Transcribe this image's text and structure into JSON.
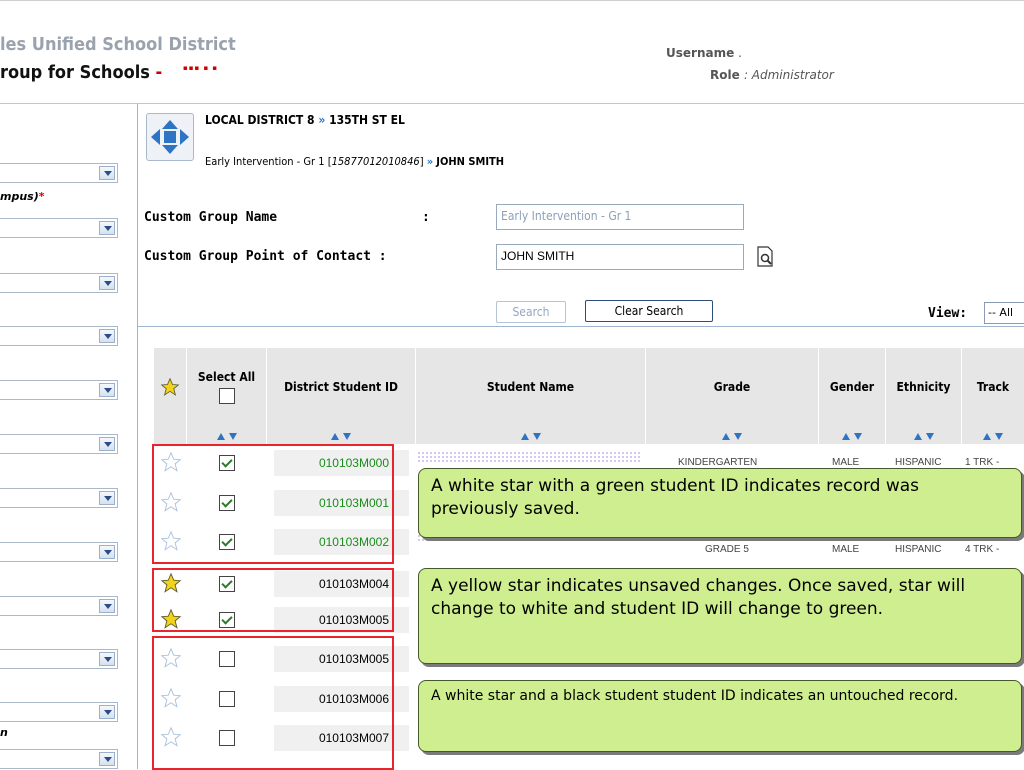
{
  "header": {
    "brand_line1": "les Unified School District",
    "brand_line2": "roup for Schools",
    "brand_dash": " -",
    "username_label": "Username",
    "username_value": " .",
    "role_label": "Role",
    "role_value": ": Administrator"
  },
  "sidebar": {
    "campus_label": "mpus)",
    "campus_required": "*",
    "last_label": "n"
  },
  "breadcrumb": {
    "line1_part1": "LOCAL DISTRICT 8",
    "separator": "»",
    "line1_part2": "135TH ST EL",
    "group_name": "Early Intervention - Gr 1 [",
    "group_id": "15877012010846",
    "group_close": "]",
    "contact": "JOHN SMITH"
  },
  "form": {
    "group_name_label": "Custom Group Name",
    "group_name_colon": ":",
    "group_name_value": "Early Intervention -  Gr 1",
    "contact_label": "Custom Group Point of Contact :",
    "contact_value": "JOHN SMITH",
    "search_button": "Search",
    "clear_button": "Clear Search",
    "view_label": "View:",
    "view_value": "-- All"
  },
  "table": {
    "headers": {
      "select_all": "Select All",
      "district_id": "District Student ID",
      "student_name": "Student Name",
      "grade": "Grade",
      "gender": "Gender",
      "ethnicity": "Ethnicity",
      "track": "Track"
    },
    "rows": [
      {
        "id": "010103M000",
        "star": "white",
        "checked": true,
        "saved": true
      },
      {
        "id": "010103M001",
        "star": "white",
        "checked": true,
        "saved": true
      },
      {
        "id": "010103M002",
        "star": "white",
        "checked": true,
        "saved": true
      },
      {
        "id": "010103M004",
        "star": "yellow",
        "checked": true,
        "saved": false
      },
      {
        "id": "010103M005",
        "star": "yellow",
        "checked": true,
        "saved": false
      },
      {
        "id": "010103M005",
        "star": "white",
        "checked": false,
        "saved": false
      },
      {
        "id": "010103M006",
        "star": "white",
        "checked": false,
        "saved": false
      },
      {
        "id": "010103M007",
        "star": "white",
        "checked": false,
        "saved": false
      }
    ],
    "peek_grade_row3": "GRADE 5",
    "peek_gender_row3": "MALE",
    "peek_eth_row3": "HISPANIC",
    "peek_track_row3": "4 TRK - ",
    "peek_grade_row1": "KINDERGARTEN",
    "peek_gender_row1": "MALE",
    "peek_eth_row1": "HISPANIC",
    "peek_track_row1": "1 TRK - "
  },
  "callouts": {
    "saved": "A white star with a green student ID indicates record was previously saved.",
    "unsaved": "A yellow star indicates unsaved changes. Once saved, star will change to white and student ID will change to green.",
    "untouched": "A white star and a black student student ID indicates an untouched record."
  },
  "colors": {
    "saved_id": "#1a8c1a",
    "callout_bg": "#cfee8f",
    "highlight_box": "#e8242c",
    "unsaved_star": "#f2d21b"
  }
}
